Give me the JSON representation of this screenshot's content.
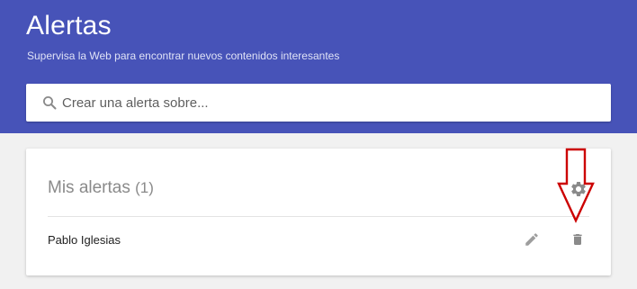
{
  "header": {
    "title": "Alertas",
    "subtitle": "Supervisa la Web para encontrar nuevos contenidos interesantes"
  },
  "search": {
    "placeholder": "Crear una alerta sobre...",
    "icon": "search-icon"
  },
  "alerts_card": {
    "title": "Mis alertas",
    "count": "(1)",
    "settings_icon": "gear-icon",
    "items": [
      {
        "label": "Pablo Iglesias",
        "edit_icon": "pencil-icon",
        "delete_icon": "trash-icon"
      }
    ]
  },
  "colors": {
    "header_bg": "#4753b8",
    "page_bg": "#f1f1f1",
    "annotation_arrow": "#cc0000"
  }
}
